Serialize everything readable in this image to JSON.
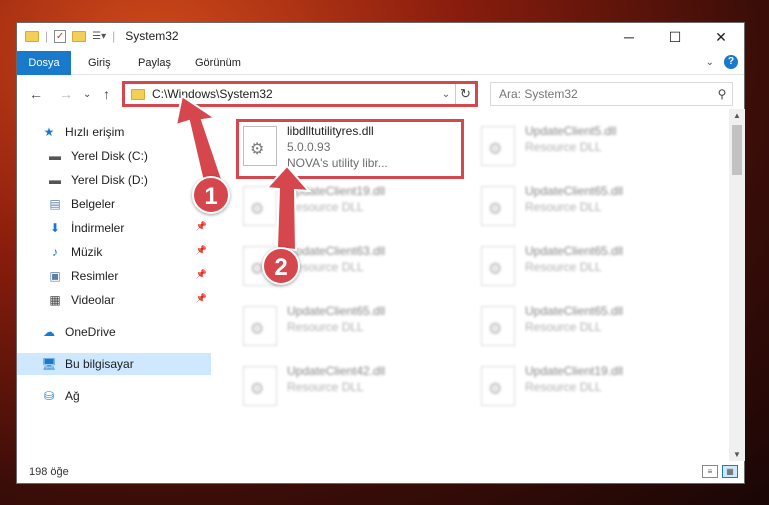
{
  "window": {
    "title": "System32",
    "minimize_icon": "minimize-icon",
    "maximize_icon": "maximize-icon",
    "close_icon": "close-icon"
  },
  "ribbon": {
    "tabs": [
      "Dosya",
      "Giriş",
      "Paylaş",
      "Görünüm"
    ]
  },
  "address": {
    "path": "C:\\Windows\\System32"
  },
  "search": {
    "placeholder": "Ara: System32"
  },
  "sidebar": {
    "items": [
      {
        "label": "Hızlı erişim",
        "icon": "star-icon"
      },
      {
        "label": "Yerel Disk (C:)",
        "icon": "drive-icon"
      },
      {
        "label": "Yerel Disk (D:)",
        "icon": "drive-icon"
      },
      {
        "label": "Belgeler",
        "icon": "documents-icon"
      },
      {
        "label": "İndirmeler",
        "icon": "download-icon"
      },
      {
        "label": "Müzik",
        "icon": "music-icon"
      },
      {
        "label": "Resimler",
        "icon": "pictures-icon"
      },
      {
        "label": "Videolar",
        "icon": "video-icon"
      },
      {
        "label": "OneDrive",
        "icon": "cloud-icon"
      },
      {
        "label": "Bu bilgisayar",
        "icon": "computer-icon"
      },
      {
        "label": "Ağ",
        "icon": "network-icon"
      }
    ]
  },
  "files": {
    "highlighted": {
      "name": "libdlltutilityres.dll",
      "version": "5.0.0.93",
      "description": "NOVA's utility libr..."
    },
    "blurred": [
      {
        "name": "UpdateClient5.dll",
        "desc": "Resource DLL"
      },
      {
        "name": "UpdateClient19.dll",
        "desc": "Resource DLL"
      },
      {
        "name": "UpdateClient65.dll",
        "desc": "Resource DLL"
      },
      {
        "name": "UpdateClient63.dll",
        "desc": "Resource DLL"
      },
      {
        "name": "UpdateClient65.dll",
        "desc": "Resource DLL"
      },
      {
        "name": "UpdateClient65.dll",
        "desc": "Resource DLL"
      },
      {
        "name": "UpdateClient65.dll",
        "desc": "Resource DLL"
      },
      {
        "name": "UpdateClient42.dll",
        "desc": "Resource DLL"
      },
      {
        "name": "UpdateClient19.dll",
        "desc": "Resource DLL"
      }
    ]
  },
  "status": {
    "count": "198 öğe"
  },
  "callouts": [
    "1",
    "2"
  ],
  "colors": {
    "accent": "#1979ca",
    "highlight": "#d6474d",
    "selected": "#cde8ff"
  }
}
